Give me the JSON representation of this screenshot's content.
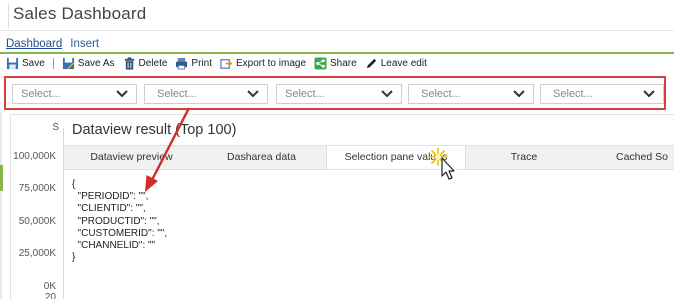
{
  "app": {
    "title": "Sales Dashboard"
  },
  "menu": {
    "tabs": [
      {
        "label": "Dashboard"
      },
      {
        "label": "Insert"
      }
    ]
  },
  "toolbar": {
    "save": "Save",
    "save_as": "Save As",
    "delete": "Delete",
    "print": "Print",
    "export": "Export to image",
    "share": "Share",
    "leave_edit": "Leave edit"
  },
  "filters": {
    "selects": [
      {
        "placeholder": "Select..."
      },
      {
        "placeholder": "Select..."
      },
      {
        "placeholder": "Select..."
      },
      {
        "placeholder": "Select..."
      },
      {
        "placeholder": "Select..."
      }
    ]
  },
  "chart": {
    "y_ticks": [
      "100,000K",
      "75,000K",
      "50,000K",
      "25,000K",
      "0K"
    ],
    "partial_char": "S",
    "bottom_fragment": "20"
  },
  "dataview": {
    "title": "Dataview result (Top 100)",
    "tabs": [
      {
        "label": "Dataview preview"
      },
      {
        "label": "Dasharea data"
      },
      {
        "label": "Selection pane values"
      },
      {
        "label": "Trace"
      },
      {
        "label": "Cached So"
      }
    ],
    "active_tab_index": 2,
    "json_lines": [
      "{",
      "  \"PERIODID\": \"\",",
      "  \"CLIENTID\": \"\",",
      "  \"PRODUCTID\": \"\",",
      "  \"CUSTOMERID\": \"\",",
      "  \"CHANNELID\": \"\"",
      "}"
    ]
  },
  "colors": {
    "accent_green": "#8ab54a",
    "highlight_red": "#d94040",
    "link_blue": "#2a5c9a"
  }
}
